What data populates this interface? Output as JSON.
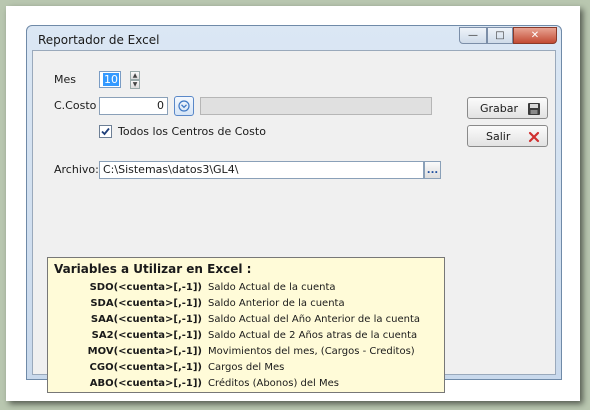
{
  "window": {
    "title": "Reportador de Excel",
    "min_label": "—",
    "max_label": "□",
    "close_label": "✕"
  },
  "form": {
    "mes_label": "Mes",
    "mes_value": "10",
    "ccosto_label": "C.Costo",
    "ccosto_value": "0",
    "ccosto_desc": "",
    "todos_label": "Todos los Centros de Costo",
    "todos_checked": true,
    "archivo_label": "Archivo:",
    "archivo_value": "C:\\Sistemas\\datos3\\GL4\\",
    "browse_label": "..."
  },
  "buttons": {
    "grabar": "Grabar",
    "salir": "Salir"
  },
  "variables": {
    "title": "Variables a Utilizar en Excel :",
    "items": [
      {
        "fn": "SDO(<cuenta>[,-1])",
        "desc": "Saldo Actual de la cuenta"
      },
      {
        "fn": "SDA(<cuenta>[,-1])",
        "desc": "Saldo Anterior de la cuenta"
      },
      {
        "fn": "SAA(<cuenta>[,-1])",
        "desc": "Saldo Actual del Año Anterior de la cuenta"
      },
      {
        "fn": "SA2(<cuenta>[,-1])",
        "desc": "Saldo Actual de 2 Años atras de la cuenta"
      },
      {
        "fn": "MOV(<cuenta>[,-1])",
        "desc": "Movimientos del mes, (Cargos - Creditos)"
      },
      {
        "fn": "CGO(<cuenta>[,-1])",
        "desc": "Cargos del Mes"
      },
      {
        "fn": "ABO(<cuenta>[,-1])",
        "desc": "Créditos (Abonos) del Mes"
      }
    ]
  },
  "colors": {
    "accent": "#3399ff",
    "close_red": "#c24a33",
    "panel_bg": "#fffbd8"
  }
}
